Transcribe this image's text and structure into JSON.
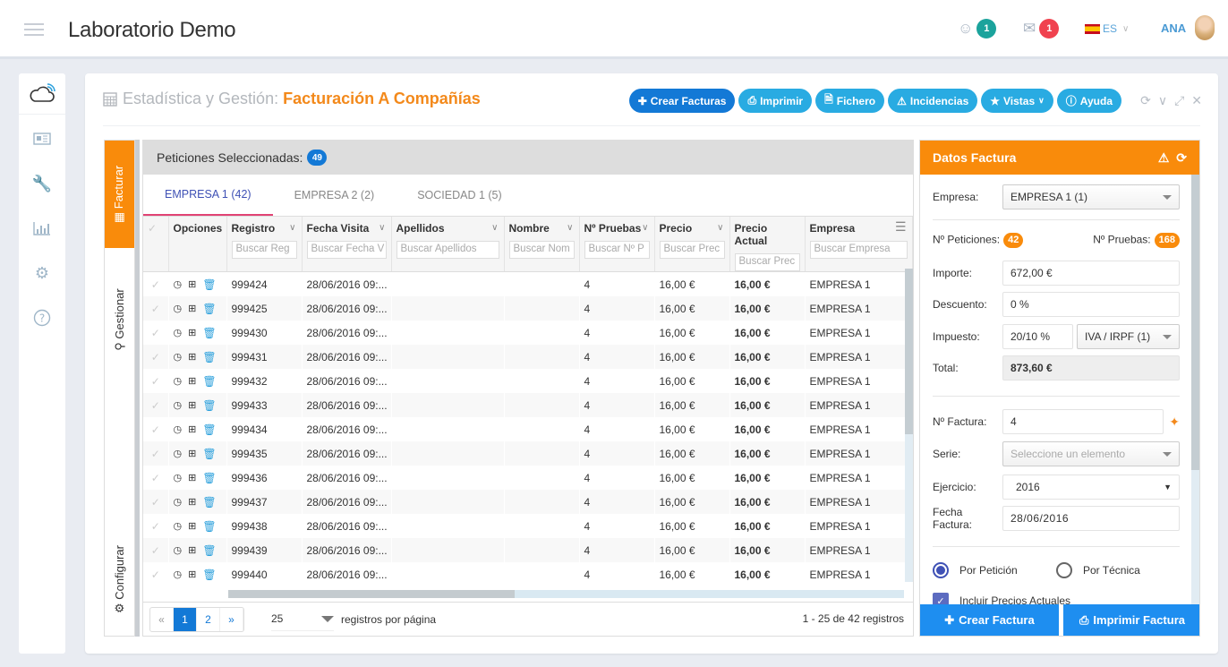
{
  "header": {
    "app_title": "Laboratorio Demo",
    "users_count": "1",
    "messages_count": "1",
    "language": "ES",
    "user_name": "ANA",
    "colors": {
      "users_badge": "#1ba39c",
      "messages_badge": "#f0424f"
    }
  },
  "leftnav": {
    "items": [
      "cloud-logo-icon",
      "id-card-icon",
      "wrench-icon",
      "bar-chart-icon",
      "gear-icon",
      "help-icon"
    ]
  },
  "page": {
    "breadcrumb_prefix": "Estadística y Gestión:",
    "breadcrumb_current": "Facturación A Compañías",
    "buttons": {
      "crear_facturas": "Crear Facturas",
      "imprimir": "Imprimir",
      "fichero": "Fichero",
      "incidencias": "Incidencias",
      "vistas": "Vistas",
      "ayuda": "Ayuda"
    }
  },
  "side_tabs": {
    "facturar": "Facturar",
    "gestionar": "Gestionar",
    "configurar": "Configurar"
  },
  "grid": {
    "title": "Peticiones Seleccionadas:",
    "selected_count": "49",
    "tabs": [
      "EMPRESA 1 (42)",
      "EMPRESA 2 (2)",
      "SOCIEDAD 1 (5)"
    ],
    "columns": [
      {
        "label": "Opciones",
        "filter": ""
      },
      {
        "label": "Registro",
        "filter": "Buscar Reg"
      },
      {
        "label": "Fecha Visita",
        "filter": "Buscar Fecha V"
      },
      {
        "label": "Apellidos",
        "filter": "Buscar Apellidos"
      },
      {
        "label": "Nombre",
        "filter": "Buscar Nom"
      },
      {
        "label": "Nº Pruebas",
        "filter": "Buscar Nº P"
      },
      {
        "label": "Precio",
        "filter": "Buscar Prec"
      },
      {
        "label": "Precio Actual",
        "filter": "Buscar Prec"
      },
      {
        "label": "Empresa",
        "filter": "Buscar Empresa"
      }
    ],
    "rows": [
      {
        "registro": "999424",
        "fecha": "28/06/2016 09:...",
        "apellidos": "",
        "nombre": "",
        "pruebas": "4",
        "precio": "16,00 €",
        "precio_actual": "16,00 €",
        "empresa": "EMPRESA 1"
      },
      {
        "registro": "999425",
        "fecha": "28/06/2016 09:...",
        "apellidos": "",
        "nombre": "",
        "pruebas": "4",
        "precio": "16,00 €",
        "precio_actual": "16,00 €",
        "empresa": "EMPRESA 1"
      },
      {
        "registro": "999430",
        "fecha": "28/06/2016 09:...",
        "apellidos": "",
        "nombre": "",
        "pruebas": "4",
        "precio": "16,00 €",
        "precio_actual": "16,00 €",
        "empresa": "EMPRESA 1"
      },
      {
        "registro": "999431",
        "fecha": "28/06/2016 09:...",
        "apellidos": "",
        "nombre": "",
        "pruebas": "4",
        "precio": "16,00 €",
        "precio_actual": "16,00 €",
        "empresa": "EMPRESA 1"
      },
      {
        "registro": "999432",
        "fecha": "28/06/2016 09:...",
        "apellidos": "",
        "nombre": "",
        "pruebas": "4",
        "precio": "16,00 €",
        "precio_actual": "16,00 €",
        "empresa": "EMPRESA 1"
      },
      {
        "registro": "999433",
        "fecha": "28/06/2016 09:...",
        "apellidos": "",
        "nombre": "",
        "pruebas": "4",
        "precio": "16,00 €",
        "precio_actual": "16,00 €",
        "empresa": "EMPRESA 1"
      },
      {
        "registro": "999434",
        "fecha": "28/06/2016 09:...",
        "apellidos": "",
        "nombre": "",
        "pruebas": "4",
        "precio": "16,00 €",
        "precio_actual": "16,00 €",
        "empresa": "EMPRESA 1"
      },
      {
        "registro": "999435",
        "fecha": "28/06/2016 09:...",
        "apellidos": "",
        "nombre": "",
        "pruebas": "4",
        "precio": "16,00 €",
        "precio_actual": "16,00 €",
        "empresa": "EMPRESA 1"
      },
      {
        "registro": "999436",
        "fecha": "28/06/2016 09:...",
        "apellidos": "",
        "nombre": "",
        "pruebas": "4",
        "precio": "16,00 €",
        "precio_actual": "16,00 €",
        "empresa": "EMPRESA 1"
      },
      {
        "registro": "999437",
        "fecha": "28/06/2016 09:...",
        "apellidos": "",
        "nombre": "",
        "pruebas": "4",
        "precio": "16,00 €",
        "precio_actual": "16,00 €",
        "empresa": "EMPRESA 1"
      },
      {
        "registro": "999438",
        "fecha": "28/06/2016 09:...",
        "apellidos": "",
        "nombre": "",
        "pruebas": "4",
        "precio": "16,00 €",
        "precio_actual": "16,00 €",
        "empresa": "EMPRESA 1"
      },
      {
        "registro": "999439",
        "fecha": "28/06/2016 09:...",
        "apellidos": "",
        "nombre": "",
        "pruebas": "4",
        "precio": "16,00 €",
        "precio_actual": "16,00 €",
        "empresa": "EMPRESA 1"
      },
      {
        "registro": "999440",
        "fecha": "28/06/2016 09:...",
        "apellidos": "",
        "nombre": "",
        "pruebas": "4",
        "precio": "16,00 €",
        "precio_actual": "16,00 €",
        "empresa": "EMPRESA 1"
      }
    ],
    "pager": {
      "pages": [
        "«",
        "1",
        "2",
        "»"
      ],
      "current_page": "1",
      "page_size": "25",
      "page_size_label": "registros por página",
      "info": "1 - 25 de 42 registros"
    }
  },
  "invoice": {
    "title": "Datos Factura",
    "empresa_label": "Empresa:",
    "empresa_value": "EMPRESA 1 (1)",
    "peticiones_label": "Nº Peticiones:",
    "peticiones_value": "42",
    "pruebas_label": "Nº Pruebas:",
    "pruebas_value": "168",
    "importe_label": "Importe:",
    "importe_value": "672,00 €",
    "descuento_label": "Descuento:",
    "descuento_value": "0 %",
    "impuesto_label": "Impuesto:",
    "impuesto_value": "20/10 %",
    "impuesto_type": "IVA / IRPF (1)",
    "total_label": "Total:",
    "total_value": "873,60 €",
    "factura_label": "Nº Factura:",
    "factura_value": "4",
    "serie_label": "Serie:",
    "serie_placeholder": "Seleccione un elemento",
    "ejercicio_label": "Ejercicio:",
    "ejercicio_value": "2016",
    "fecha_label": "Fecha Factura:",
    "fecha_value": "28/06/2016",
    "radio_peticion": "Por Petición",
    "radio_tecnica": "Por Técnica",
    "radio_selected": "Por Petición",
    "checkbox_label": "Incluir Precios Actuales",
    "checkbox_checked": true,
    "btn_crear": "Crear Factura",
    "btn_imprimir": "Imprimir Factura"
  }
}
